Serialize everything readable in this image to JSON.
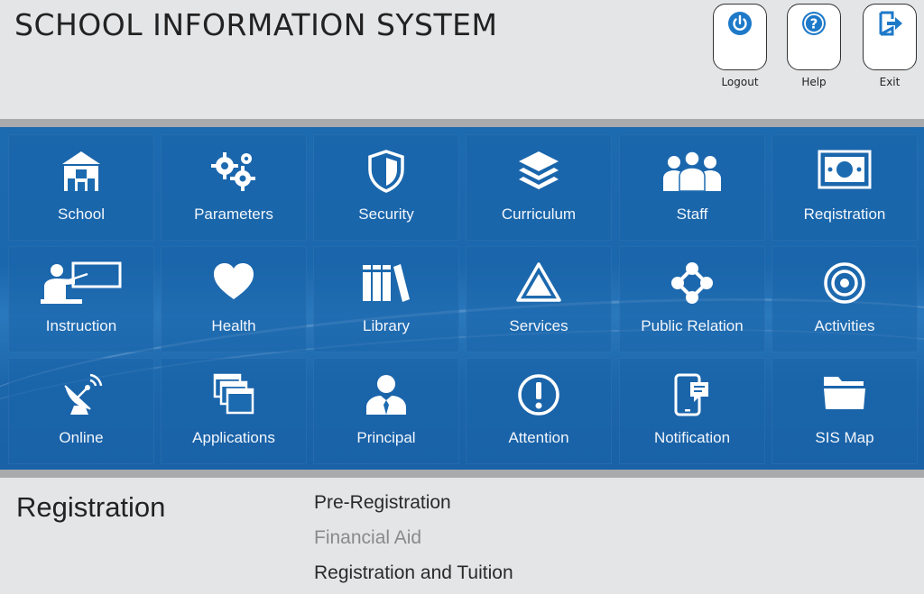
{
  "header": {
    "title": "SCHOOL INFORMATION SYSTEM",
    "buttons": [
      {
        "label": "Logout",
        "icon": "power-icon"
      },
      {
        "label": "Help",
        "icon": "question-icon"
      },
      {
        "label": "Exit",
        "icon": "exit-icon"
      }
    ]
  },
  "tiles": [
    {
      "label": "School",
      "icon": "school-building-icon"
    },
    {
      "label": "Parameters",
      "icon": "gears-icon"
    },
    {
      "label": "Security",
      "icon": "shield-icon"
    },
    {
      "label": "Curriculum",
      "icon": "layers-icon"
    },
    {
      "label": "Staff",
      "icon": "people-group-icon"
    },
    {
      "label": "Reqistration",
      "icon": "money-bill-icon"
    },
    {
      "label": "Instruction",
      "icon": "teacher-board-icon"
    },
    {
      "label": "Health",
      "icon": "heart-icon"
    },
    {
      "label": "Library",
      "icon": "books-icon"
    },
    {
      "label": "Services",
      "icon": "triangle-icon"
    },
    {
      "label": "Public Relation",
      "icon": "network-icon"
    },
    {
      "label": "Activities",
      "icon": "target-icon"
    },
    {
      "label": "Online",
      "icon": "satellite-dish-icon"
    },
    {
      "label": "Applications",
      "icon": "windows-icon"
    },
    {
      "label": "Principal",
      "icon": "person-tie-icon"
    },
    {
      "label": "Attention",
      "icon": "exclamation-icon"
    },
    {
      "label": "Notification",
      "icon": "phone-message-icon"
    },
    {
      "label": "SIS Map",
      "icon": "folder-icon"
    }
  ],
  "section": {
    "title": "Registration",
    "items": [
      {
        "label": "Pre-Registration",
        "color": "#2a2a2a"
      },
      {
        "label": "Financial Aid",
        "color": "#8a8a8a"
      },
      {
        "label": "Registration and Tuition",
        "color": "#2a2a2a"
      }
    ]
  },
  "colors": {
    "panel_blue": "#1c6ab0",
    "tile_text": "#ffffff",
    "icon_blue": "#1e79c8"
  }
}
